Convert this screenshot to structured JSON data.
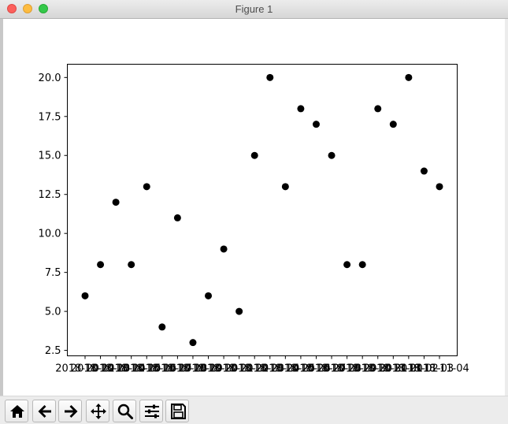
{
  "window": {
    "title": "Figure 1"
  },
  "toolbar": {
    "buttons": [
      {
        "name": "home",
        "icon": "home-icon"
      },
      {
        "name": "back",
        "icon": "arrow-left-icon"
      },
      {
        "name": "forward",
        "icon": "arrow-right-icon"
      },
      {
        "name": "pan",
        "icon": "move-icon"
      },
      {
        "name": "zoom",
        "icon": "zoom-icon"
      },
      {
        "name": "configure-subplots",
        "icon": "sliders-icon"
      },
      {
        "name": "save",
        "icon": "save-icon"
      }
    ]
  },
  "chart_data": {
    "type": "scatter",
    "title": "",
    "xlabel": "",
    "ylabel": "",
    "marker_color": "#000000",
    "ylim": [
      2.15,
      20.85
    ],
    "yticks": [
      2.5,
      5.0,
      7.5,
      10.0,
      12.5,
      15.0,
      17.5,
      20.0
    ],
    "ytick_labels": [
      "2.5",
      "5.0",
      "7.5",
      "10.0",
      "12.5",
      "15.0",
      "17.5",
      "20.0"
    ],
    "xtick_labels": [
      "2018-10-12",
      "2018-10-13",
      "2018-10-14",
      "2018-10-15",
      "2018-10-16",
      "2018-10-17",
      "2018-10-18",
      "2018-10-19",
      "2018-10-20",
      "2018-10-21",
      "2018-10-22",
      "2018-10-23",
      "2018-10-24",
      "2018-10-25",
      "2018-10-26",
      "2018-10-27",
      "2018-10-28",
      "2018-10-29",
      "2018-10-30",
      "2018-10-31",
      "2018-11-01",
      "2018-11-02",
      "2018-11-03",
      "2018-11-04"
    ],
    "y": [
      6,
      8,
      12,
      8,
      13,
      4,
      11,
      3,
      6,
      9,
      5,
      15,
      20,
      13,
      18,
      17,
      15,
      8,
      8,
      18,
      17,
      20,
      14,
      13
    ],
    "grid": false
  }
}
